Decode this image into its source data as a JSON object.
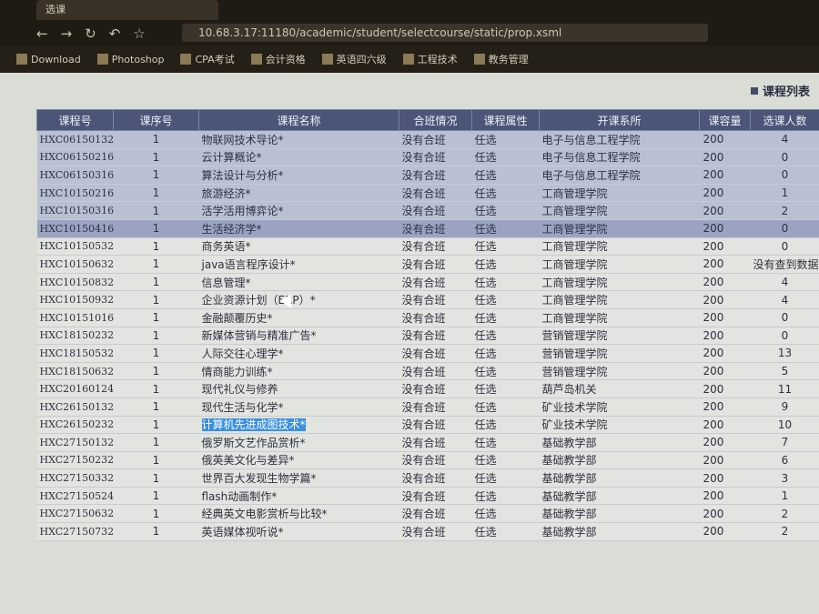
{
  "browser": {
    "tab_title": "选课",
    "url": "10.68.3.17:11180/academic/student/selectcourse/static/prop.xsml",
    "bookmarks": [
      "Download",
      "Photoshop",
      "CPA考试",
      "会计资格",
      "英语四六级",
      "工程技术",
      "教务管理"
    ]
  },
  "page": {
    "list_title": "课程列表"
  },
  "table": {
    "headers": [
      "课程号",
      "课序号",
      "课程名称",
      "合班情况",
      "课程属性",
      "开课系所",
      "课容量",
      "选课人数"
    ],
    "rows": [
      {
        "code": "HXC06150132",
        "seq": "1",
        "name": "物联网技术导论*",
        "merge": "没有合班",
        "attr": "任选",
        "dept": "电子与信息工程学院",
        "cap": "200",
        "count": "4"
      },
      {
        "code": "HXC06150216",
        "seq": "1",
        "name": "云计算概论*",
        "merge": "没有合班",
        "attr": "任选",
        "dept": "电子与信息工程学院",
        "cap": "200",
        "count": "0"
      },
      {
        "code": "HXC06150316",
        "seq": "1",
        "name": "算法设计与分析*",
        "merge": "没有合班",
        "attr": "任选",
        "dept": "电子与信息工程学院",
        "cap": "200",
        "count": "0"
      },
      {
        "code": "HXC10150216",
        "seq": "1",
        "name": "旅游经济*",
        "merge": "没有合班",
        "attr": "任选",
        "dept": "工商管理学院",
        "cap": "200",
        "count": "1"
      },
      {
        "code": "HXC10150316",
        "seq": "1",
        "name": "活学活用博弈论*",
        "merge": "没有合班",
        "attr": "任选",
        "dept": "工商管理学院",
        "cap": "200",
        "count": "2"
      },
      {
        "code": "HXC10150416",
        "seq": "1",
        "name": "生活经济学*",
        "merge": "没有合班",
        "attr": "任选",
        "dept": "工商管理学院",
        "cap": "200",
        "count": "0"
      },
      {
        "code": "HXC10150532",
        "seq": "1",
        "name": "商务英语*",
        "merge": "没有合班",
        "attr": "任选",
        "dept": "工商管理学院",
        "cap": "200",
        "count": "0"
      },
      {
        "code": "HXC10150632",
        "seq": "1",
        "name": "java语言程序设计*",
        "merge": "没有合班",
        "attr": "任选",
        "dept": "工商管理学院",
        "cap": "200",
        "count": "没有查到数据"
      },
      {
        "code": "HXC10150832",
        "seq": "1",
        "name": "信息管理*",
        "merge": "没有合班",
        "attr": "任选",
        "dept": "工商管理学院",
        "cap": "200",
        "count": "4"
      },
      {
        "code": "HXC10150932",
        "seq": "1",
        "name": "企业资源计划（ERP）*",
        "merge": "没有合班",
        "attr": "任选",
        "dept": "工商管理学院",
        "cap": "200",
        "count": "4"
      },
      {
        "code": "HXC10151016",
        "seq": "1",
        "name": "金融颠覆历史*",
        "merge": "没有合班",
        "attr": "任选",
        "dept": "工商管理学院",
        "cap": "200",
        "count": "0"
      },
      {
        "code": "HXC18150232",
        "seq": "1",
        "name": "新媒体营销与精准广告*",
        "merge": "没有合班",
        "attr": "任选",
        "dept": "营销管理学院",
        "cap": "200",
        "count": "0"
      },
      {
        "code": "HXC18150532",
        "seq": "1",
        "name": "人际交往心理学*",
        "merge": "没有合班",
        "attr": "任选",
        "dept": "营销管理学院",
        "cap": "200",
        "count": "13"
      },
      {
        "code": "HXC18150632",
        "seq": "1",
        "name": "情商能力训练*",
        "merge": "没有合班",
        "attr": "任选",
        "dept": "营销管理学院",
        "cap": "200",
        "count": "5"
      },
      {
        "code": "HXC20160124",
        "seq": "1",
        "name": "现代礼仪与修养",
        "merge": "没有合班",
        "attr": "任选",
        "dept": "葫芦岛机关",
        "cap": "200",
        "count": "11"
      },
      {
        "code": "HXC26150132",
        "seq": "1",
        "name": "现代生活与化学*",
        "merge": "没有合班",
        "attr": "任选",
        "dept": "矿业技术学院",
        "cap": "200",
        "count": "9"
      },
      {
        "code": "HXC26150232",
        "seq": "1",
        "name": "计算机先进成图技术*",
        "merge": "没有合班",
        "attr": "任选",
        "dept": "矿业技术学院",
        "cap": "200",
        "count": "10"
      },
      {
        "code": "HXC27150132",
        "seq": "1",
        "name": "俄罗斯文艺作品赏析*",
        "merge": "没有合班",
        "attr": "任选",
        "dept": "基础教学部",
        "cap": "200",
        "count": "7"
      },
      {
        "code": "HXC27150232",
        "seq": "1",
        "name": "俄英美文化与差异*",
        "merge": "没有合班",
        "attr": "任选",
        "dept": "基础教学部",
        "cap": "200",
        "count": "6"
      },
      {
        "code": "HXC27150332",
        "seq": "1",
        "name": "世界百大发现生物学篇*",
        "merge": "没有合班",
        "attr": "任选",
        "dept": "基础教学部",
        "cap": "200",
        "count": "3"
      },
      {
        "code": "HXC27150524",
        "seq": "1",
        "name": "flash动画制作*",
        "merge": "没有合班",
        "attr": "任选",
        "dept": "基础教学部",
        "cap": "200",
        "count": "1"
      },
      {
        "code": "HXC27150632",
        "seq": "1",
        "name": "经典英文电影赏析与比较*",
        "merge": "没有合班",
        "attr": "任选",
        "dept": "基础教学部",
        "cap": "200",
        "count": "2"
      },
      {
        "code": "HXC27150732",
        "seq": "1",
        "name": "英语媒体视听说*",
        "merge": "没有合班",
        "attr": "任选",
        "dept": "基础教学部",
        "cap": "200",
        "count": "2"
      }
    ]
  }
}
